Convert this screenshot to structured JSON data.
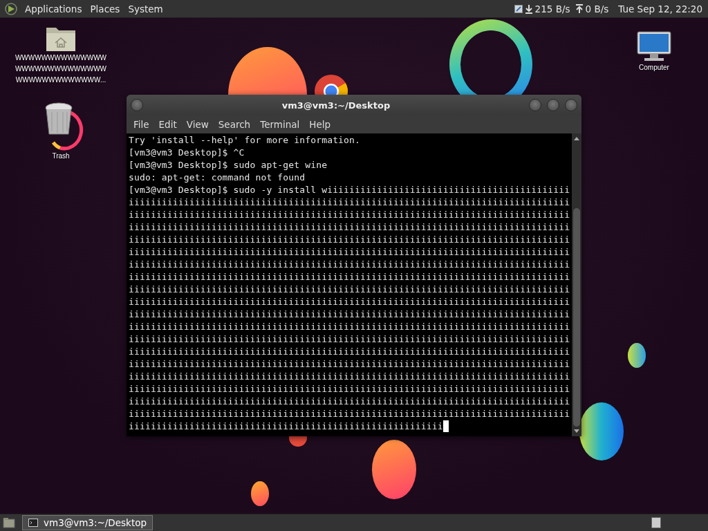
{
  "top_panel": {
    "menus": [
      "Applications",
      "Places",
      "System"
    ],
    "download_rate": "215 B/s",
    "upload_rate": "0 B/s",
    "clock": "Tue Sep 12, 22:20"
  },
  "desktop_icons": [
    {
      "kind": "folder",
      "label_lines": [
        "WWWWWWWWWWWWWW",
        "WWWWWWWWWWWWWW",
        "WWWWWWWWWWWWW..."
      ]
    },
    {
      "kind": "trash",
      "label_lines": [
        "Trash"
      ]
    },
    {
      "kind": "computer",
      "label_lines": [
        "Computer"
      ]
    }
  ],
  "terminal": {
    "title": "vm3@vm3:~/Desktop",
    "menus": [
      "File",
      "Edit",
      "View",
      "Search",
      "Terminal",
      "Help"
    ],
    "lines": [
      "Try 'install --help' for more information.",
      "[vm3@vm3 Desktop]$ ^C",
      "[vm3@vm3 Desktop]$ sudo apt-get wine",
      "sudo: apt-get: command not found",
      "[vm3@vm3 Desktop]$ sudo -y install wiiiiiiiiiiiiiiiiiiiiiiiiiiiiiiiiiiiiiiiiiiii",
      "iiiiiiiiiiiiiiiiiiiiiiiiiiiiiiiiiiiiiiiiiiiiiiiiiiiiiiiiiiiiiiiiiiiiiiiiiiiiiiii",
      "iiiiiiiiiiiiiiiiiiiiiiiiiiiiiiiiiiiiiiiiiiiiiiiiiiiiiiiiiiiiiiiiiiiiiiiiiiiiiiii",
      "iiiiiiiiiiiiiiiiiiiiiiiiiiiiiiiiiiiiiiiiiiiiiiiiiiiiiiiiiiiiiiiiiiiiiiiiiiiiiiii",
      "iiiiiiiiiiiiiiiiiiiiiiiiiiiiiiiiiiiiiiiiiiiiiiiiiiiiiiiiiiiiiiiiiiiiiiiiiiiiiiii",
      "iiiiiiiiiiiiiiiiiiiiiiiiiiiiiiiiiiiiiiiiiiiiiiiiiiiiiiiiiiiiiiiiiiiiiiiiiiiiiiii",
      "iiiiiiiiiiiiiiiiiiiiiiiiiiiiiiiiiiiiiiiiiiiiiiiiiiiiiiiiiiiiiiiiiiiiiiiiiiiiiiii",
      "iiiiiiiiiiiiiiiiiiiiiiiiiiiiiiiiiiiiiiiiiiiiiiiiiiiiiiiiiiiiiiiiiiiiiiiiiiiiiiii",
      "iiiiiiiiiiiiiiiiiiiiiiiiiiiiiiiiiiiiiiiiiiiiiiiiiiiiiiiiiiiiiiiiiiiiiiiiiiiiiiii",
      "iiiiiiiiiiiiiiiiiiiiiiiiiiiiiiiiiiiiiiiiiiiiiiiiiiiiiiiiiiiiiiiiiiiiiiiiiiiiiiii",
      "iiiiiiiiiiiiiiiiiiiiiiiiiiiiiiiiiiiiiiiiiiiiiiiiiiiiiiiiiiiiiiiiiiiiiiiiiiiiiiii",
      "iiiiiiiiiiiiiiiiiiiiiiiiiiiiiiiiiiiiiiiiiiiiiiiiiiiiiiiiiiiiiiiiiiiiiiiiiiiiiiii",
      "iiiiiiiiiiiiiiiiiiiiiiiiiiiiiiiiiiiiiiiiiiiiiiiiiiiiiiiiiiiiiiiiiiiiiiiiiiiiiiii",
      "iiiiiiiiiiiiiiiiiiiiiiiiiiiiiiiiiiiiiiiiiiiiiiiiiiiiiiiiiiiiiiiiiiiiiiiiiiiiiiii",
      "iiiiiiiiiiiiiiiiiiiiiiiiiiiiiiiiiiiiiiiiiiiiiiiiiiiiiiiiiiiiiiiiiiiiiiiiiiiiiiii",
      "iiiiiiiiiiiiiiiiiiiiiiiiiiiiiiiiiiiiiiiiiiiiiiiiiiiiiiiiiiiiiiiiiiiiiiiiiiiiiiii",
      "iiiiiiiiiiiiiiiiiiiiiiiiiiiiiiiiiiiiiiiiiiiiiiiiiiiiiiiiiiiiiiiiiiiiiiiiiiiiiiii",
      "iiiiiiiiiiiiiiiiiiiiiiiiiiiiiiiiiiiiiiiiiiiiiiiiiiiiiiiiiiiiiiiiiiiiiiiiiiiiiiii",
      "iiiiiiiiiiiiiiiiiiiiiiiiiiiiiiiiiiiiiiiiiiiiiiiiiiiiiiiiiiiiiiiiiiiiiiiiiiiiiiii",
      "iiiiiiiiiiiiiiiiiiiiiiiiiiiiiiiiiiiiiiiiiiiiiiiiiiiiiiiii"
    ]
  },
  "taskbar": {
    "tasks": [
      {
        "label": "vm3@vm3:~/Desktop",
        "selected": true
      }
    ]
  }
}
